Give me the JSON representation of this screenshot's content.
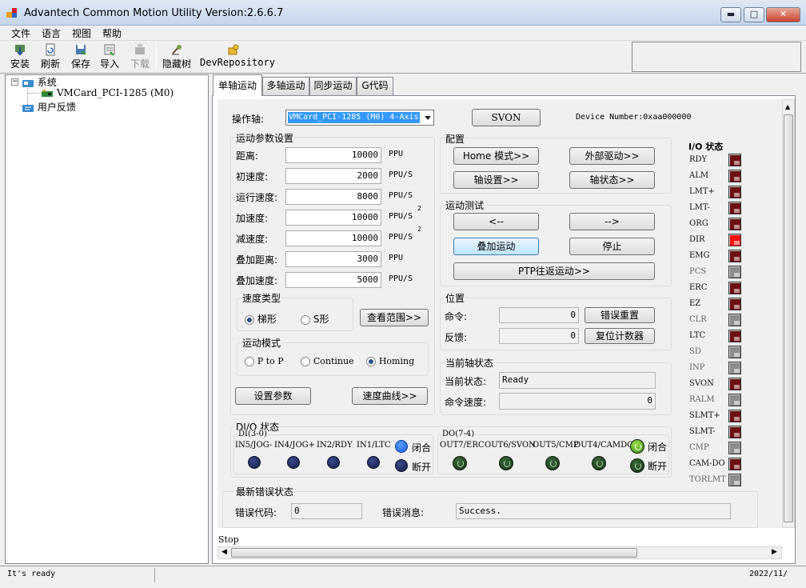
{
  "window": {
    "title": "Advantech Common Motion Utility  Version:2.6.6.7",
    "min_glyph": "▬",
    "max_glyph": "□",
    "close_glyph": "✕"
  },
  "menu": [
    "文件",
    "语言",
    "视图",
    "帮助"
  ],
  "toolbar": {
    "install": "安装",
    "refresh": "刷新",
    "save": "保存",
    "import": "导入",
    "download": "下载",
    "hide_tree": "隐藏树",
    "dev_repo": "DevRepository"
  },
  "tree": {
    "root": "系统",
    "device": "VMCard_PCI-1285 (M0)",
    "feedback": "用户反馈",
    "expander": "−"
  },
  "tabs": [
    "单轴运动",
    "多轴运动",
    "同步运动",
    "G代码"
  ],
  "axis": {
    "label": "操作轴:",
    "selected": "VMCard_PCI-1285 (M0) 4-Axis",
    "svon": "SVON",
    "device_number": "Device Number:0xaa000000"
  },
  "motion_params": {
    "title": "运动参数设置",
    "rows": [
      {
        "label": "距离:",
        "value": "10000",
        "unit": "PPU",
        "sup": ""
      },
      {
        "label": "初速度:",
        "value": "2000",
        "unit": "PPU/S",
        "sup": ""
      },
      {
        "label": "运行速度:",
        "value": "8000",
        "unit": "PPU/S",
        "sup": ""
      },
      {
        "label": "加速度:",
        "value": "10000",
        "unit": "PPU/S",
        "sup": "2"
      },
      {
        "label": "减速度:",
        "value": "10000",
        "unit": "PPU/S",
        "sup": "2"
      },
      {
        "label": "叠加距离:",
        "value": "3000",
        "unit": "PPU",
        "sup": ""
      },
      {
        "label": "叠加速度:",
        "value": "5000",
        "unit": "PPU/S",
        "sup": ""
      }
    ],
    "speed_type": {
      "title": "速度类型",
      "opt1": "梯形",
      "opt2": "S形",
      "view_range": "查看范围>>"
    },
    "motion_mode": {
      "title": "运动模式",
      "opt1": "P to P",
      "opt2": "Continue",
      "opt3": "Homing"
    },
    "set_params": "设置参数",
    "speed_curve": "速度曲线>>"
  },
  "config": {
    "title": "配置",
    "home_mode": "Home 模式>>",
    "external_drive": "外部驱动>>",
    "axis_settings": "轴设置>>",
    "axis_status": "轴状态>>"
  },
  "motion_test": {
    "title": "运动测试",
    "left": "<--",
    "right": "-->",
    "overlay": "叠加运动",
    "stop": "停止",
    "ptp": "PTP往返运动>>"
  },
  "position": {
    "title": "位置",
    "command_label": "命令:",
    "command_value": "0",
    "error_reset": "错误重置",
    "feedback_label": "反馈:",
    "feedback_value": "0",
    "reset_counter": "复位计数器"
  },
  "axis_state": {
    "title": "当前轴状态",
    "state_label": "当前状态:",
    "state_value": "Ready",
    "cmd_speed_label": "命令速度:",
    "cmd_speed_value": "0"
  },
  "dio": {
    "title": "DI/O 状态",
    "di_title": "DI(3-0)",
    "di": [
      "IN5/JOG-",
      "IN4/JOG+",
      "IN2/RDY",
      "IN1/LTC"
    ],
    "di_legend_closed": "闭合",
    "di_legend_open": "断开",
    "do_title": "DO(7-4)",
    "do": [
      "OUT7/ERC",
      "OUT6/SVON",
      "OUT5/CMP",
      "OUT4/CAMDO"
    ],
    "do_legend_closed": "闭合",
    "do_legend_open": "断开"
  },
  "io_status": {
    "title": "I/O 状态",
    "items": [
      {
        "name": "RDY",
        "state": "dark"
      },
      {
        "name": "ALM",
        "state": "dark"
      },
      {
        "name": "LMT+",
        "state": "dark"
      },
      {
        "name": "LMT-",
        "state": "dark"
      },
      {
        "name": "ORG",
        "state": "dark"
      },
      {
        "name": "DIR",
        "state": "red"
      },
      {
        "name": "EMG",
        "state": "dark"
      },
      {
        "name": "PCS",
        "state": "gray"
      },
      {
        "name": "ERC",
        "state": "dark"
      },
      {
        "name": "EZ",
        "state": "dark"
      },
      {
        "name": "CLR",
        "state": "gray"
      },
      {
        "name": "LTC",
        "state": "dark"
      },
      {
        "name": "SD",
        "state": "gray"
      },
      {
        "name": "INP",
        "state": "gray"
      },
      {
        "name": "SVON",
        "state": "dark"
      },
      {
        "name": "RALM",
        "state": "gray"
      },
      {
        "name": "SLMT+",
        "state": "dark"
      },
      {
        "name": "SLMT-",
        "state": "dark"
      },
      {
        "name": "CMP",
        "state": "gray"
      },
      {
        "name": "CAM-DO",
        "state": "dark"
      },
      {
        "name": "TORLMT",
        "state": "gray"
      }
    ]
  },
  "last_error": {
    "title": "最新错误状态",
    "code_label": "错误代码:",
    "code_value": "0",
    "msg_label": "错误消息:",
    "msg_value": "Success."
  },
  "stop_text": "Stop",
  "status": {
    "left": "It's ready",
    "right": "2022/11/"
  },
  "colors": {
    "led_dark": "#6b0e0e",
    "led_red": "#ff0a0a",
    "led_gray": "#8c8c8c",
    "accent": "#3399ff"
  }
}
